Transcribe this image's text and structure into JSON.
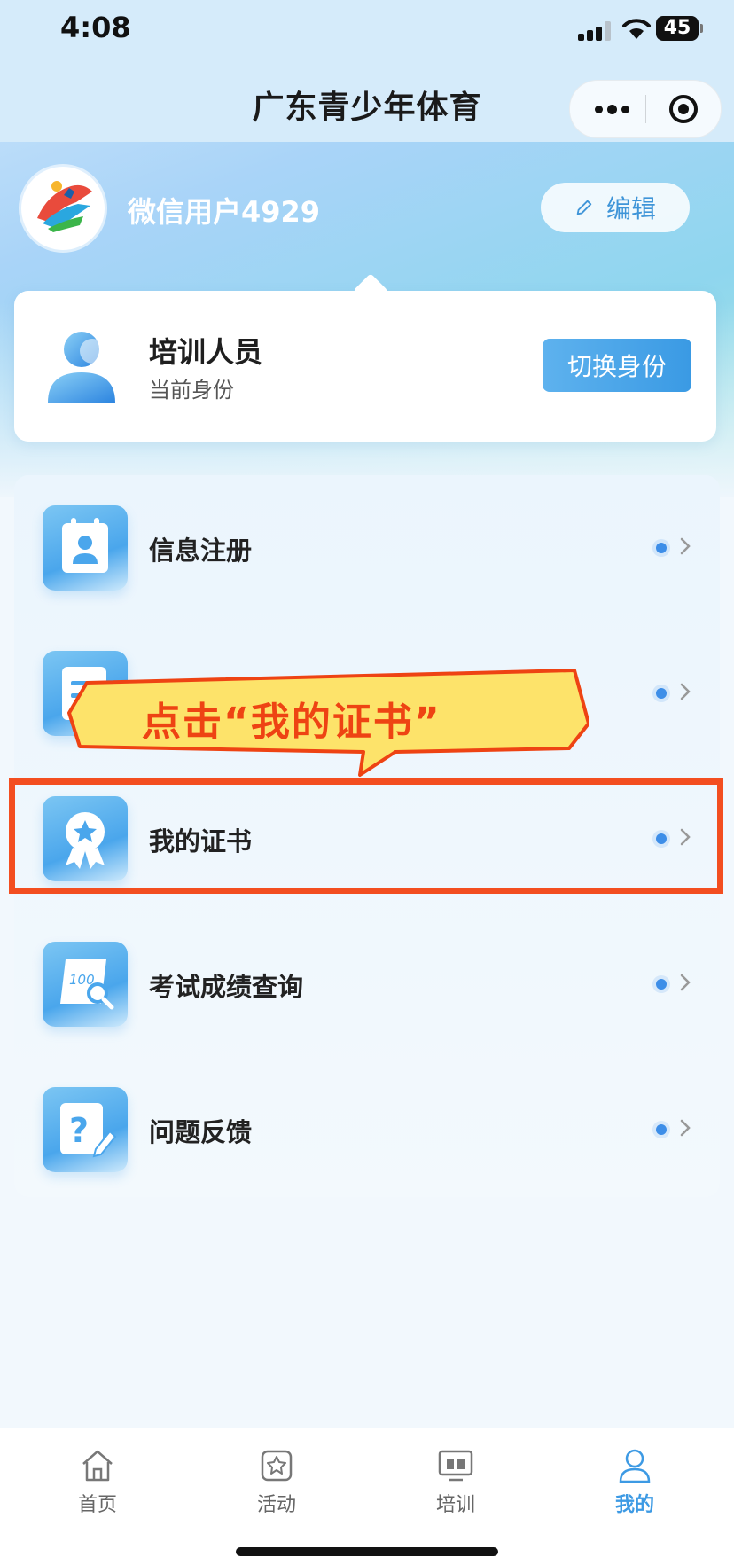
{
  "status_bar": {
    "time": "4:08",
    "battery": "45"
  },
  "nav": {
    "title": "广东青少年体育"
  },
  "profile": {
    "avatar_logo_text": "广东青少年体育",
    "user_name": "微信用户4929",
    "edit_label": "编辑"
  },
  "identity": {
    "title": "培训人员",
    "subtitle": "当前身份",
    "switch_label": "切换身份"
  },
  "menu": {
    "items": [
      {
        "label": "信息注册",
        "icon": "register-card-icon"
      },
      {
        "label": "",
        "icon": "document-icon"
      },
      {
        "label": "我的证书",
        "icon": "certificate-icon"
      },
      {
        "label": "考试成绩查询",
        "icon": "score-search-icon"
      },
      {
        "label": "问题反馈",
        "icon": "feedback-icon"
      }
    ]
  },
  "annotation": {
    "callout_text": "点击“我的证书”"
  },
  "tabbar": {
    "tabs": [
      {
        "label": "首页",
        "icon": "home-icon",
        "active": false
      },
      {
        "label": "活动",
        "icon": "activity-icon",
        "active": false
      },
      {
        "label": "培训",
        "icon": "training-icon",
        "active": false
      },
      {
        "label": "我的",
        "icon": "profile-icon",
        "active": true
      }
    ]
  },
  "colors": {
    "accent": "#3d9ae4",
    "highlight": "#f34e20",
    "callout_fill": "#fde36a"
  }
}
